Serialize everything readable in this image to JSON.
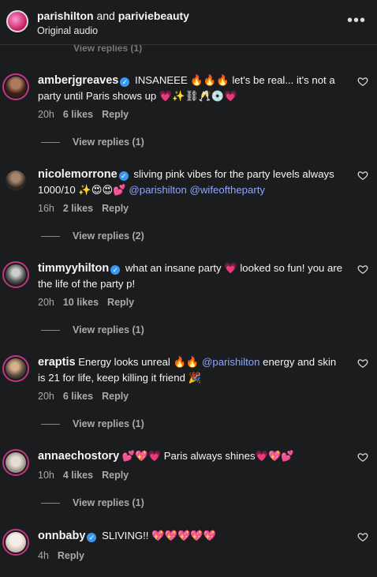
{
  "header": {
    "user1": "parishilton",
    "and": " and ",
    "user2": "pariviebeauty",
    "subtitle": "Original audio",
    "more_icon": "more-horizontal-icon"
  },
  "ghost_text": "View replies (1)",
  "comments": [
    {
      "username": "amberjgreaves",
      "text_parts": [
        "INSANEEE 🔥🔥🔥 let's be real... it's not a party until Paris shows up 💗✨⛓🥂💿💗"
      ],
      "mentions": [],
      "time": "20h",
      "likes": "6 likes",
      "reply": "Reply",
      "view_replies": "View replies (1)",
      "avatar_color": "#6b3a2e"
    },
    {
      "username": "nicolemorrone",
      "text_parts": [
        "sliving pink vibes for the party levels always 1000/10 ✨😍😍💕 "
      ],
      "mentions": [
        "@parishilton",
        "@wifeoftheparty"
      ],
      "time": "16h",
      "likes": "2 likes",
      "reply": "Reply",
      "view_replies": "View replies (2)",
      "avatar_color": "#3b3530"
    },
    {
      "username": "timmyyhilton",
      "text_parts": [
        "what an insane party 💗 looked so fun! you are the life of the party p!"
      ],
      "mentions": [],
      "time": "20h",
      "likes": "10 likes",
      "reply": "Reply",
      "view_replies": "View replies (1)",
      "avatar_color": "#8a8a8a"
    },
    {
      "username": "eraptis",
      "text_parts": [
        "Energy looks unreal 🔥🔥 ",
        " energy and skin is 21 for life, keep killing it friend 🎉"
      ],
      "mentions": [
        "@parishilton"
      ],
      "time": "20h",
      "likes": "6 likes",
      "reply": "Reply",
      "view_replies": "View replies (1)",
      "avatar_color": "#6e5a48"
    },
    {
      "username": "annaechostory",
      "text_parts": [
        "💕💖💗 Paris always shines💗💖💕"
      ],
      "mentions": [],
      "time": "10h",
      "likes": "4 likes",
      "reply": "Reply",
      "view_replies": "View replies (1)",
      "avatar_color": "#c9c4bf"
    },
    {
      "username": "onnbaby",
      "text_parts": [
        "SLIVING!! 💖💖💖💖💖"
      ],
      "mentions": [],
      "time": "4h",
      "likes": "",
      "reply": "Reply",
      "view_replies": "",
      "avatar_color": "#e8ddd6"
    }
  ],
  "colors": {
    "background": "#1b1c1e",
    "mention": "#8fa7ff",
    "verified": "#3897f0",
    "story_ring": "#c13584"
  }
}
